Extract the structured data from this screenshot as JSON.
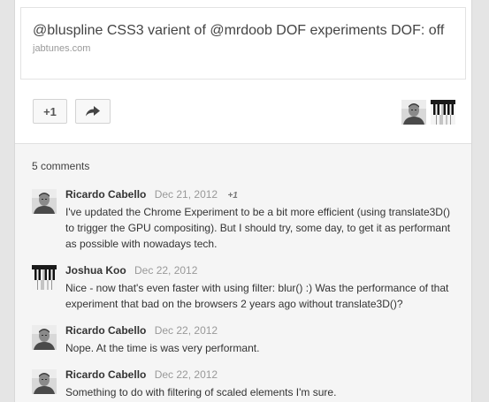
{
  "link": {
    "title": "@bluspline CSS3 varient of @mrdoob DOF experiments DOF: off",
    "domain": "jabtunes.com"
  },
  "actions": {
    "plus_one_label": "+1",
    "share_icon": "share-arrow-icon"
  },
  "sharers": [
    {
      "avatar": "ricardo-avatar"
    },
    {
      "avatar": "piano-keys-avatar"
    }
  ],
  "comments": {
    "count_label": "5 comments",
    "items": [
      {
        "author": "Ricardo Cabello",
        "date": "Dec 21, 2012",
        "plus": "+1",
        "avatar": "ricardo-avatar",
        "text": "I've updated the Chrome Experiment to be a bit more efficient (using translate3D() to trigger the GPU compositing). But I should try, some day, to get it as performant as possible with nowadays tech."
      },
      {
        "author": "Joshua Koo",
        "date": "Dec 22, 2012",
        "avatar": "piano-keys-avatar",
        "text": "Nice - now that's even faster with using filter: blur() :) Was the performance of that experiment that bad on the browsers 2 years ago without translate3D()?"
      },
      {
        "author": "Ricardo Cabello",
        "date": "Dec 22, 2012",
        "avatar": "ricardo-avatar",
        "text": "Nope. At the time is was very performant."
      },
      {
        "author": "Ricardo Cabello",
        "date": "Dec 22, 2012",
        "avatar": "ricardo-avatar",
        "text": "Something to do with filtering of scaled elements I'm sure."
      }
    ]
  }
}
